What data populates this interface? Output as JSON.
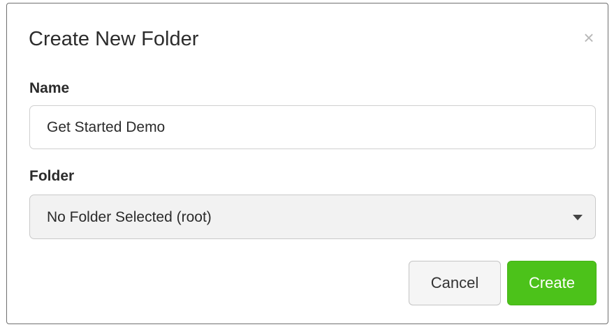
{
  "dialog": {
    "title": "Create New Folder",
    "close_icon": "close-icon",
    "close_glyph": "×"
  },
  "form": {
    "name_label": "Name",
    "name_value": "Get Started Demo",
    "folder_label": "Folder",
    "folder_selected": "No Folder Selected (root)",
    "folder_caret_icon": "caret-down-icon"
  },
  "actions": {
    "cancel_label": "Cancel",
    "create_label": "Create",
    "create_color": "#4cc21a"
  }
}
